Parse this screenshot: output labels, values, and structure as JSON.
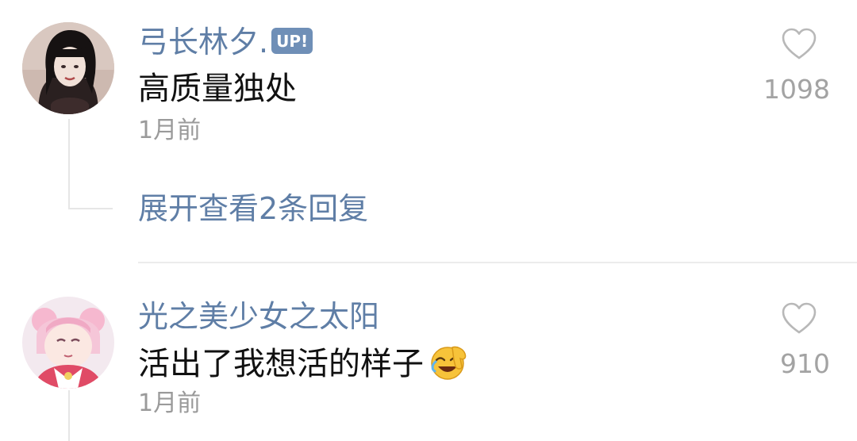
{
  "comments": [
    {
      "username": "弓长林夕.",
      "badge": "UP!",
      "text": "高质量独处",
      "time": "1月前",
      "likes": "1098",
      "avatar": "avatar-girl-dark-hair"
    },
    {
      "username": "光之美少女之太阳",
      "text": "活出了我想活的样子",
      "emoji": "laughing-crying-emoji",
      "time": "1月前",
      "likes": "910",
      "avatar": "avatar-anime-pink-hair"
    }
  ],
  "replies": {
    "expand_label": "展开查看2条回复"
  },
  "icons": {
    "like": "heart-outline-icon"
  },
  "colors": {
    "username": "#5f7ea6",
    "text": "#111111",
    "meta": "#9a9a9a",
    "badge": "#6f8fb7"
  }
}
